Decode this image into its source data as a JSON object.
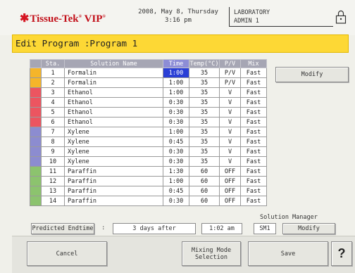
{
  "header": {
    "logo": "Tissue-Tek",
    "logo_suffix": "VIP",
    "date": "2008, May 8, Thursday",
    "time": "3:16 pm",
    "lab": "LABORATORY",
    "user": "ADMIN 1"
  },
  "title": "Edit Program :Program 1",
  "table": {
    "headers": [
      "Sta.",
      "Solution Name",
      "Time",
      "Temp(°C)",
      "P/V",
      "Mix"
    ],
    "rows": [
      {
        "color": "#f5b52a",
        "sta": "1",
        "name": "Formalin",
        "time": "1:00",
        "temp": "35",
        "pv": "P/V",
        "mix": "Fast"
      },
      {
        "color": "#f5b52a",
        "sta": "2",
        "name": "Formalin",
        "time": "1:00",
        "temp": "35",
        "pv": "P/V",
        "mix": "Fast"
      },
      {
        "color": "#ec5560",
        "sta": "3",
        "name": "Ethanol",
        "time": "1:00",
        "temp": "35",
        "pv": "V",
        "mix": "Fast"
      },
      {
        "color": "#ec5560",
        "sta": "4",
        "name": "Ethanol",
        "time": "0:30",
        "temp": "35",
        "pv": "V",
        "mix": "Fast"
      },
      {
        "color": "#ec5560",
        "sta": "5",
        "name": "Ethanol",
        "time": "0:30",
        "temp": "35",
        "pv": "V",
        "mix": "Fast"
      },
      {
        "color": "#ec5560",
        "sta": "6",
        "name": "Ethanol",
        "time": "0:30",
        "temp": "35",
        "pv": "V",
        "mix": "Fast"
      },
      {
        "color": "#8c8cd0",
        "sta": "7",
        "name": "Xylene",
        "time": "1:00",
        "temp": "35",
        "pv": "V",
        "mix": "Fast"
      },
      {
        "color": "#8c8cd0",
        "sta": "8",
        "name": "Xylene",
        "time": "0:45",
        "temp": "35",
        "pv": "V",
        "mix": "Fast"
      },
      {
        "color": "#8c8cd0",
        "sta": "9",
        "name": "Xylene",
        "time": "0:30",
        "temp": "35",
        "pv": "V",
        "mix": "Fast"
      },
      {
        "color": "#8c8cd0",
        "sta": "10",
        "name": "Xylene",
        "time": "0:30",
        "temp": "35",
        "pv": "V",
        "mix": "Fast"
      },
      {
        "color": "#8cc36e",
        "sta": "11",
        "name": "Paraffin",
        "time": "1:30",
        "temp": "60",
        "pv": "OFF",
        "mix": "Fast"
      },
      {
        "color": "#8cc36e",
        "sta": "12",
        "name": "Paraffin",
        "time": "1:00",
        "temp": "60",
        "pv": "OFF",
        "mix": "Fast"
      },
      {
        "color": "#8cc36e",
        "sta": "13",
        "name": "Paraffin",
        "time": "0:45",
        "temp": "60",
        "pv": "OFF",
        "mix": "Fast"
      },
      {
        "color": "#8cc36e",
        "sta": "14",
        "name": "Paraffin",
        "time": "0:30",
        "temp": "60",
        "pv": "OFF",
        "mix": "Fast"
      }
    ]
  },
  "buttons": {
    "modify": "Modify",
    "predicted": "Predicted Endtime",
    "solution_manager_label": "Solution Manager",
    "sm_modify": "Modify",
    "cancel": "Cancel",
    "mixing_mode_1": "Mixing Mode",
    "mixing_mode_2": "Selection",
    "save": "Save",
    "help": "?"
  },
  "fields": {
    "separator": ":",
    "days_after": "3 days after",
    "end_time": "1:02 am",
    "sm_value": "SM1"
  },
  "colors": {
    "title_bar": "#fdd835",
    "selected_cell": "#2a3fd6",
    "logo": "#c2101a"
  }
}
